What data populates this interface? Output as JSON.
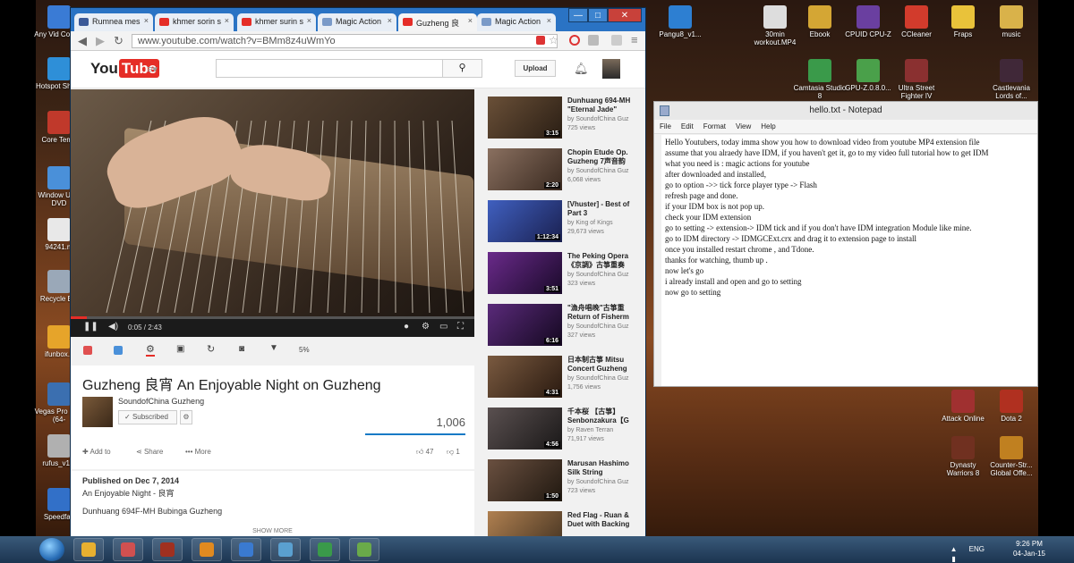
{
  "desktop": {
    "left_icons": [
      {
        "label": "Any Vid Conver",
        "color": "#3a7bd5"
      },
      {
        "label": "Hotspot Shield",
        "color": "#2e8fd8"
      },
      {
        "label": "Core Temp",
        "color": "#c0392b"
      },
      {
        "label": "Window USB DVD",
        "color": "#4a90d9"
      },
      {
        "label": "94241.m",
        "color": "#e8e8e8"
      },
      {
        "label": "Recycle Bin",
        "color": "#9aa8b8"
      },
      {
        "label": "ifunbox.v",
        "color": "#e6a42a"
      },
      {
        "label": "Vegas Pro 12.0 (64-",
        "color": "#3b6fb0"
      },
      {
        "label": "rufus_v1.4",
        "color": "#b0b0b0"
      },
      {
        "label": "Speedfan",
        "color": "#3270c8"
      }
    ],
    "right_icons": [
      {
        "label": "Pangu8_v1...",
        "color": "#2d7fd2"
      },
      {
        "label": "30min workout.MP4",
        "color": "#dddddd"
      },
      {
        "label": "Ebook",
        "color": "#d4a634"
      },
      {
        "label": "CPUID CPU-Z",
        "color": "#6a3fa0"
      },
      {
        "label": "CCleaner",
        "color": "#d23b2c"
      },
      {
        "label": "Fraps",
        "color": "#e9c23a"
      },
      {
        "label": "music",
        "color": "#d9b24a"
      },
      {
        "label": "Camtasia Studio 8",
        "color": "#3a9a4a"
      },
      {
        "label": "GPU-Z.0.8.0...",
        "color": "#4aa04a"
      },
      {
        "label": "Ultra Street Fighter IV",
        "color": "#8a3030"
      },
      {
        "label": "Castlevania Lords of...",
        "color": "#402838"
      },
      {
        "label": "Attack Online",
        "color": "#a03030"
      },
      {
        "label": "Dota 2",
        "color": "#b03020"
      },
      {
        "label": "Dynasty Warriors 8",
        "color": "#703020"
      },
      {
        "label": "Counter-Str... Global Offe...",
        "color": "#c08020"
      }
    ]
  },
  "browser": {
    "tabs": [
      {
        "label": "Rumnea mes",
        "color": "#3b5998"
      },
      {
        "label": "khmer sorin s",
        "color": "#e52d27"
      },
      {
        "label": "khmer surin s",
        "color": "#e52d27"
      },
      {
        "label": "Magic Action",
        "color": "#7a9ac8"
      },
      {
        "label": "Guzheng 良",
        "color": "#e52d27"
      },
      {
        "label": "Magic Action",
        "color": "#7a9ac8"
      }
    ],
    "window_buttons": {
      "minimize": "—",
      "maximize": "□",
      "close": "✕"
    },
    "url": "www.youtube.com/watch?v=BMm8z4uWmYo"
  },
  "youtube": {
    "logo_you": "You",
    "logo_tube": "Tube",
    "upload_label": "Upload",
    "player": {
      "time": "0:05 / 2:43",
      "progress_fraction": 0.04
    },
    "action_percent": "5%",
    "video": {
      "title": "Guzheng 良宵 An Enjoyable Night on Guzheng",
      "channel": "SoundofChina Guzheng",
      "subscribed_label": "Subscribed",
      "views": "1,006",
      "add_to": "Add to",
      "share": "Share",
      "more": "More",
      "likes": "47",
      "dislikes": "1"
    },
    "description": {
      "published": "Published on Dec 7, 2014",
      "line1": "An Enjoyable Night - 良宵",
      "line2": "Dunhuang 694F-MH Bubinga Guzheng",
      "show_more": "SHOW MORE"
    },
    "recommended": [
      {
        "title1": "Dunhuang 694-MH",
        "title2": "\"Eternal Jade\"",
        "by": "by SoundofChina Guz",
        "views": "725 views",
        "dur": "3:15",
        "c1": "#6a5038",
        "c2": "#2a1e14"
      },
      {
        "title1": "Chopin Etude Op.",
        "title2": "Guzheng 7声音韵",
        "by": "by SoundofChina Guz",
        "views": "6,068 views",
        "dur": "2:20",
        "c1": "#8a7060",
        "c2": "#3a2a20"
      },
      {
        "title1": "[Vhuster] - Best of",
        "title2": "Part 3",
        "by": "by King of Kings",
        "views": "29,673 views",
        "dur": "1:12:34",
        "c1": "#4060c0",
        "c2": "#1a2050"
      },
      {
        "title1": "The Peking Opera",
        "title2": "《京調》古箏重奏",
        "by": "by SoundofChina Guz",
        "views": "323 views",
        "dur": "3:51",
        "c1": "#6a2a8a",
        "c2": "#1a0a2a"
      },
      {
        "title1": "\"漁舟唱晚\"古箏重",
        "title2": "Return of Fisherm",
        "by": "by SoundofChina Guz",
        "views": "327 views",
        "dur": "6:16",
        "c1": "#5a2a7a",
        "c2": "#140820"
      },
      {
        "title1": "日本制古箏 Mitsu",
        "title2": "Concert Guzheng",
        "by": "by SoundofChina Guz",
        "views": "1,756 views",
        "dur": "4:31",
        "c1": "#7a5a40",
        "c2": "#2a1a10"
      },
      {
        "title1": "千本桜 【古箏】",
        "title2": "Senbonzakura【G",
        "by": "by Raven Terran",
        "views": "71,917 views",
        "dur": "4:56",
        "c1": "#5a5050",
        "c2": "#1a1818"
      },
      {
        "title1": "Marusan Hashimo",
        "title2": "Silk String",
        "by": "by SoundofChina Guz",
        "views": "723 views",
        "dur": "1:50",
        "c1": "#6a5040",
        "c2": "#201810"
      },
      {
        "title1": "Red Flag - Ruan &",
        "title2": "Duet with Backing",
        "by": "",
        "views": "",
        "dur": "",
        "c1": "#b08050",
        "c2": "#403020"
      }
    ]
  },
  "notepad": {
    "title": "hello.txt - Notepad",
    "menu": [
      "File",
      "Edit",
      "Format",
      "View",
      "Help"
    ],
    "lines": [
      "Hello Youtubers, today imma show you how to download video from youtube MP4 extension file",
      "assume that you alraedy have IDM, if you  haven't  get it, go to my video full tutorial how to get IDM",
      "what you need is : magic actions for youtube",
      "after downloaded and installed,",
      "go to option ->> tick force player type -> Flash",
      "refresh page and done.",
      "if your IDM box is not pop up.",
      "check your IDM extension",
      "go to setting -> extension-> IDM tick and if you don't have IDM integration Module like mine.",
      "go to IDM directory -> IDMGCExt.crx and drag it to extension page to install",
      "once you installed restart chrome , and Tdone.",
      "thanks for watching, thumb up .",
      "now let's go",
      "i already install and open and go to setting",
      "now go to setting"
    ]
  },
  "taskbar": {
    "apps": [
      {
        "name": "chrome",
        "color": "#e8b030"
      },
      {
        "name": "paint",
        "color": "#d05050"
      },
      {
        "name": "book",
        "color": "#a03020"
      },
      {
        "name": "media-player",
        "color": "#e08a20"
      },
      {
        "name": "utility",
        "color": "#3a7ad0"
      },
      {
        "name": "explorer",
        "color": "#5aa0d0"
      },
      {
        "name": "camtasia",
        "color": "#3a9a4a"
      },
      {
        "name": "recorder",
        "color": "#6aaa4a"
      }
    ],
    "lang": "ENG",
    "time": "9:26 PM",
    "date": "04-Jan-15"
  }
}
